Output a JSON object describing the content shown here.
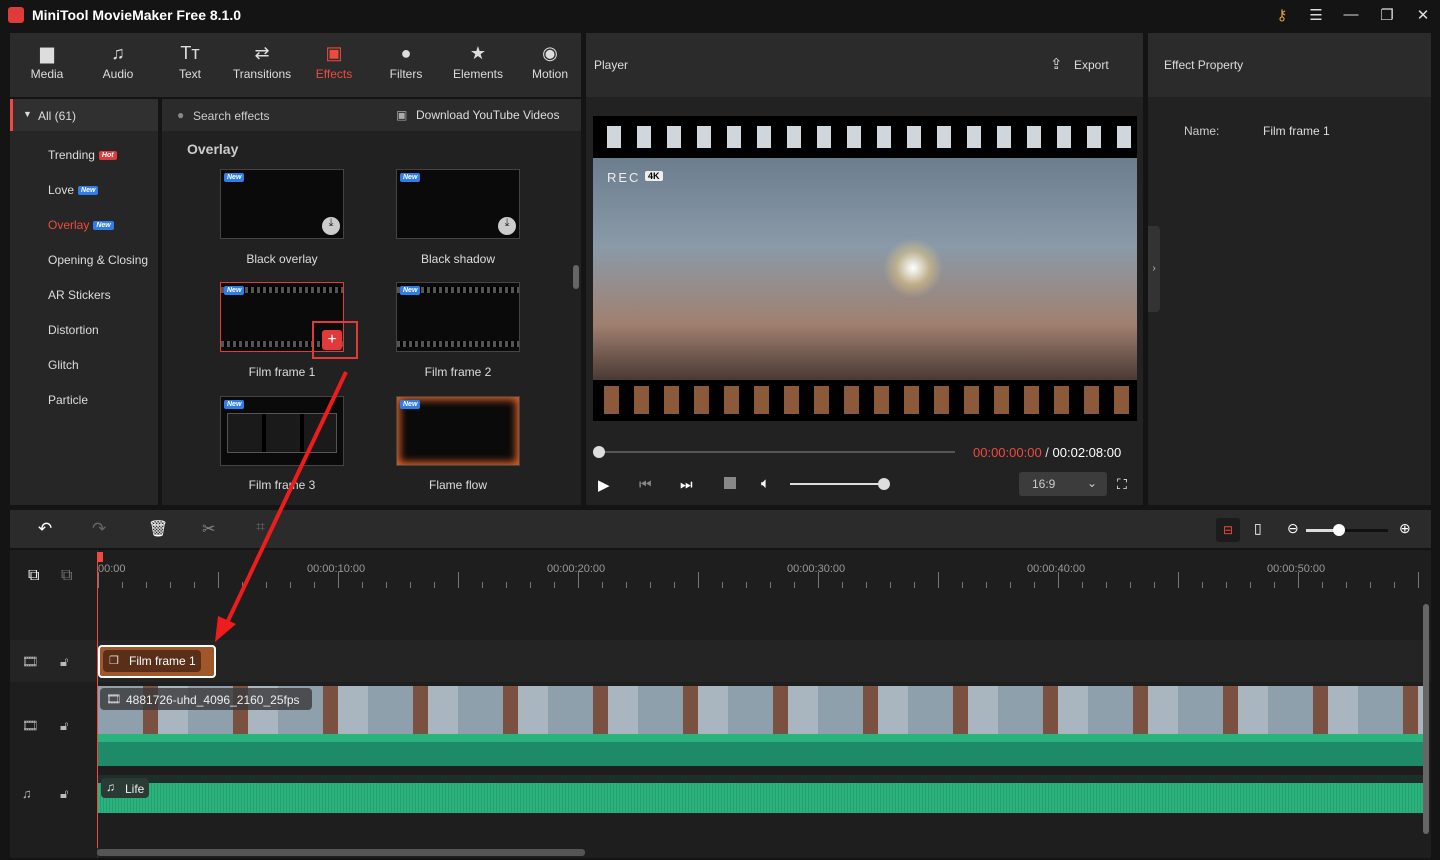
{
  "app": {
    "title": "MiniTool MovieMaker Free 8.1.0"
  },
  "toolbar": [
    {
      "label": "Media",
      "icon": "folder-icon"
    },
    {
      "label": "Audio",
      "icon": "music-icon"
    },
    {
      "label": "Text",
      "icon": "text-icon"
    },
    {
      "label": "Transitions",
      "icon": "transitions-icon"
    },
    {
      "label": "Effects",
      "icon": "effects-icon",
      "active": true
    },
    {
      "label": "Filters",
      "icon": "filters-icon"
    },
    {
      "label": "Elements",
      "icon": "elements-icon"
    },
    {
      "label": "Motion",
      "icon": "motion-icon"
    }
  ],
  "categories": {
    "all": "All (61)",
    "items": [
      {
        "label": "Trending",
        "badge": "Hot"
      },
      {
        "label": "Love",
        "badge": "New"
      },
      {
        "label": "Overlay",
        "badge": "New",
        "active": true
      },
      {
        "label": "Opening & Closing"
      },
      {
        "label": "AR Stickers"
      },
      {
        "label": "Distortion"
      },
      {
        "label": "Glitch"
      },
      {
        "label": "Particle"
      }
    ]
  },
  "effects": {
    "search_placeholder": "Search effects",
    "download_link": "Download YouTube Videos",
    "section": "Overlay",
    "new_badge": "New",
    "items": [
      {
        "label": "Black overlay"
      },
      {
        "label": "Black shadow"
      },
      {
        "label": "Film frame 1",
        "selected": true
      },
      {
        "label": "Film frame 2"
      },
      {
        "label": "Film frame 3"
      },
      {
        "label": "Flame flow"
      }
    ]
  },
  "player": {
    "title": "Player",
    "export": "Export",
    "rec": "REC",
    "rec_badge": "4K",
    "current_time": "00:00:00:00",
    "separator": " / ",
    "total_time": "00:02:08:00",
    "progress": 0,
    "volume": 1.0,
    "aspect": "16:9"
  },
  "property": {
    "title": "Effect Property",
    "name_label": "Name:",
    "name_value": "Film frame 1"
  },
  "timeline": {
    "ruler": [
      "00:00",
      "00:00:10:00",
      "00:00:20:00",
      "00:00:30:00",
      "00:00:40:00",
      "00:00:50:00"
    ],
    "effect_clip": "Film frame 1",
    "video_clip": "4881726-uhd_4096_2160_25fps",
    "audio_clip": "Life",
    "zoom": 0.4
  },
  "colors": {
    "accent": "#f04a3e",
    "audio": "#2bb37e",
    "effect_clip": "#a0582a"
  }
}
